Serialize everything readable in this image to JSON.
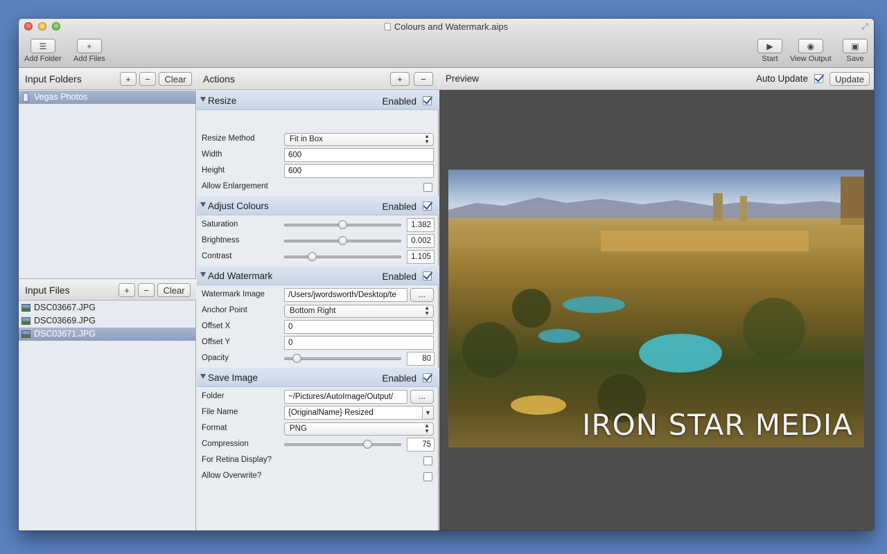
{
  "window": {
    "title": "Colours and Watermark.aips"
  },
  "toolbar": {
    "add_folder": "Add Folder",
    "add_files": "Add Files",
    "start": "Start",
    "view_output": "View Output",
    "save": "Save"
  },
  "input_folders": {
    "title": "Input Folders",
    "add": "+",
    "remove": "−",
    "clear": "Clear",
    "items": [
      "Vegas Photos"
    ]
  },
  "input_files": {
    "title": "Input Files",
    "add": "+",
    "remove": "−",
    "clear": "Clear",
    "items": [
      "DSC03667.JPG",
      "DSC03669.JPG",
      "DSC03671.JPG"
    ]
  },
  "actions": {
    "title": "Actions",
    "add": "+",
    "remove": "−",
    "enabled_label": "Enabled",
    "resize": {
      "name": "Resize",
      "method_label": "Resize Method",
      "method_value": "Fit in Box",
      "width_label": "Width",
      "width_value": "600",
      "height_label": "Height",
      "height_value": "600",
      "enlarge_label": "Allow Enlargement"
    },
    "colours": {
      "name": "Adjust Colours",
      "saturation_label": "Saturation",
      "saturation_value": "1.382",
      "brightness_label": "Brightness",
      "brightness_value": "0.002",
      "contrast_label": "Contrast",
      "contrast_value": "1.105"
    },
    "watermark": {
      "name": "Add Watermark",
      "image_label": "Watermark Image",
      "image_value": "/Users/jwordsworth/Desktop/te",
      "browse": "...",
      "anchor_label": "Anchor Point",
      "anchor_value": "Bottom Right",
      "offx_label": "Offset X",
      "offx_value": "0",
      "offy_label": "Offset Y",
      "offy_value": "0",
      "opacity_label": "Opacity",
      "opacity_value": "80"
    },
    "save": {
      "name": "Save Image",
      "folder_label": "Folder",
      "folder_value": "~/Pictures/AutoImage/Output/",
      "browse": "...",
      "filename_label": "File Name",
      "filename_value": "{OriginalName} Resized",
      "format_label": "Format",
      "format_value": "PNG",
      "compression_label": "Compression",
      "compression_value": "75",
      "retina_label": "For Retina Display?",
      "overwrite_label": "Allow Overwrite?"
    }
  },
  "preview": {
    "title": "Preview",
    "auto_update": "Auto Update",
    "update": "Update",
    "watermark_text": "IRON STAR MEDIA"
  },
  "sliders": {
    "saturation": 0.5,
    "brightness": 0.5,
    "contrast": 0.22,
    "opacity": 0.08,
    "compression": 0.73
  },
  "colors": {
    "accent": "#1f55b5",
    "desktop": "#5b82be",
    "preview_bg": "#4e4e4e"
  }
}
